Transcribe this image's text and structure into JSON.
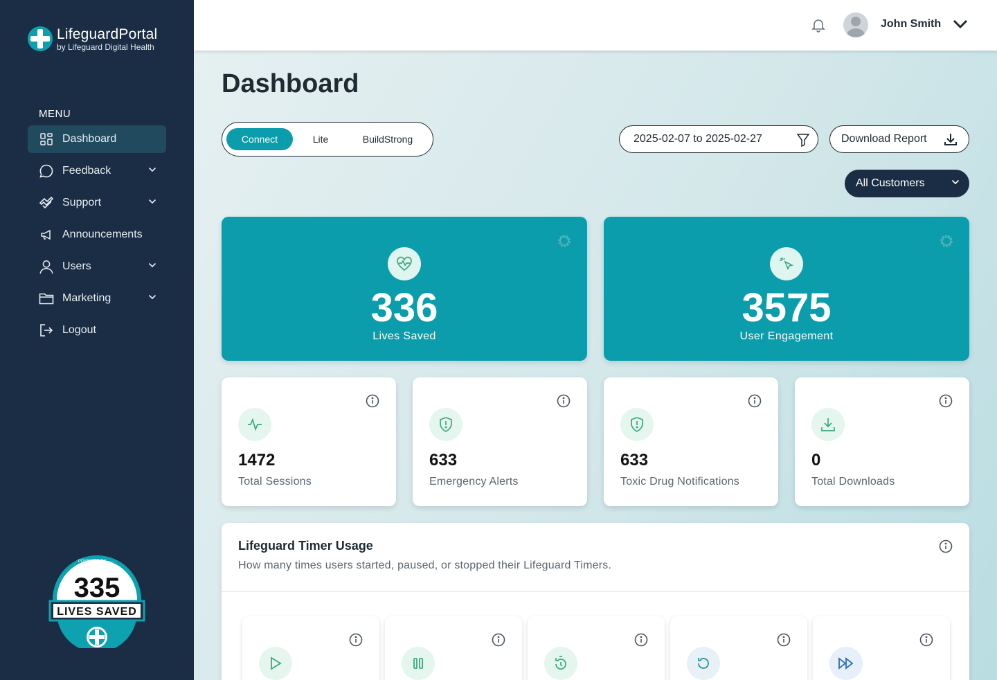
{
  "app": {
    "brand_title": "LifeguardPortal",
    "brand_subtitle": "by Lifeguard Digital Health"
  },
  "sidebar": {
    "menu_label": "MENU",
    "items": [
      {
        "label": "Dashboard",
        "icon": "grid-icon",
        "active": true,
        "has_submenu": false
      },
      {
        "label": "Feedback",
        "icon": "chat-bubble-icon",
        "active": false,
        "has_submenu": true
      },
      {
        "label": "Support",
        "icon": "handshake-icon",
        "active": false,
        "has_submenu": true
      },
      {
        "label": "Announcements",
        "icon": "megaphone-icon",
        "active": false,
        "has_submenu": false
      },
      {
        "label": "Users",
        "icon": "user-icon",
        "active": false,
        "has_submenu": true
      },
      {
        "label": "Marketing",
        "icon": "folder-icon",
        "active": false,
        "has_submenu": true
      },
      {
        "label": "Logout",
        "icon": "logout-icon",
        "active": false,
        "has_submenu": false
      }
    ],
    "badge": {
      "powered_by": "POWERED BY ······",
      "count": "335",
      "label": "LIVES SAVED"
    }
  },
  "header": {
    "user_name": "John Smith"
  },
  "page": {
    "title": "Dashboard"
  },
  "tabs": {
    "items": [
      "Connect",
      "Lite",
      "BuildStrong"
    ],
    "selected": "Connect"
  },
  "filters": {
    "date_range": "2025-02-07 to 2025-02-27",
    "download_label": "Download Report",
    "customer_select": "All Customers"
  },
  "highlights": [
    {
      "value": "336",
      "label": "Lives Saved",
      "icon": "heart-pulse-icon"
    },
    {
      "value": "3575",
      "label": "User Engagement",
      "icon": "cursor-click-icon"
    }
  ],
  "stats": [
    {
      "value": "1472",
      "label": "Total Sessions",
      "icon": "activity-icon"
    },
    {
      "value": "633",
      "label": "Emergency Alerts",
      "icon": "shield-alert-icon"
    },
    {
      "value": "633",
      "label": "Toxic Drug Notifications",
      "icon": "shield-alert-icon"
    },
    {
      "value": "0",
      "label": "Total Downloads",
      "icon": "download-icon"
    }
  ],
  "timer_usage": {
    "title": "Lifeguard Timer Usage",
    "description": "How many times users started, paused, or stopped their Lifeguard Timers.",
    "cards": [
      {
        "icon": "play-icon",
        "bg": "#e5f6ef"
      },
      {
        "icon": "pause-icon",
        "bg": "#e5f6ef"
      },
      {
        "icon": "timer-icon",
        "bg": "#e5f6ef"
      },
      {
        "icon": "restart-icon",
        "bg": "#e8f1f8"
      },
      {
        "icon": "fast-forward-icon",
        "bg": "#e6effa"
      }
    ]
  },
  "colors": {
    "sidebar_bg": "#1b2d44",
    "accent_teal": "#0b9dab",
    "active_menu_bg": "#224a5f",
    "icon_green": "#3aa97f"
  }
}
